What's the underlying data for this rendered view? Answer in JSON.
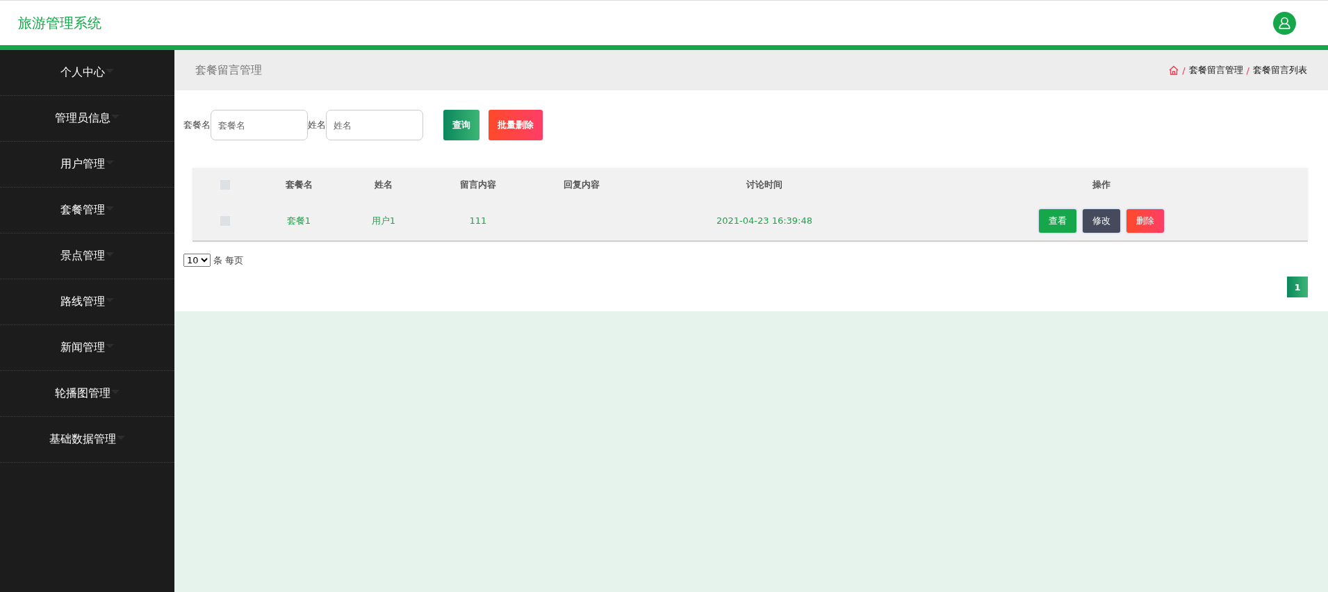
{
  "header": {
    "title": "旅游管理系统"
  },
  "sidebar": {
    "items": [
      {
        "label": "个人中心"
      },
      {
        "label": "管理员信息"
      },
      {
        "label": "用户管理"
      },
      {
        "label": "套餐管理"
      },
      {
        "label": "景点管理"
      },
      {
        "label": "路线管理"
      },
      {
        "label": "新闻管理"
      },
      {
        "label": "轮播图管理"
      },
      {
        "label": "基础数据管理"
      }
    ]
  },
  "breadcrumb_bar": {
    "title": "套餐留言管理",
    "separator": "/",
    "crumbs": [
      "套餐留言管理",
      "套餐留言列表"
    ]
  },
  "search": {
    "fields": [
      {
        "label": "套餐名",
        "placeholder": "套餐名"
      },
      {
        "label": "姓名",
        "placeholder": "姓名"
      }
    ],
    "buttons": [
      {
        "label": "查询",
        "kind": "search"
      },
      {
        "label": "批量删除",
        "kind": "delete"
      }
    ]
  },
  "table": {
    "select_all": {
      "checked": false
    },
    "columns": [
      "套餐名",
      "姓名",
      "留言内容",
      "回复内容",
      "讨论时间",
      "操作"
    ],
    "rows": [
      {
        "checked": false,
        "package": "套餐1",
        "name": "用户1",
        "message": "111",
        "time": "2021-04-23 16:39:48",
        "actions": [
          {
            "label": "查看",
            "kind": "view"
          },
          {
            "label": "修改",
            "kind": "edit"
          },
          {
            "label": "删除",
            "kind": "delete"
          }
        ]
      }
    ]
  },
  "pagination": {
    "page_size": "10",
    "page_size_suffix": "条 每页",
    "pages": [
      {
        "label": "1",
        "selected": true
      }
    ]
  }
}
